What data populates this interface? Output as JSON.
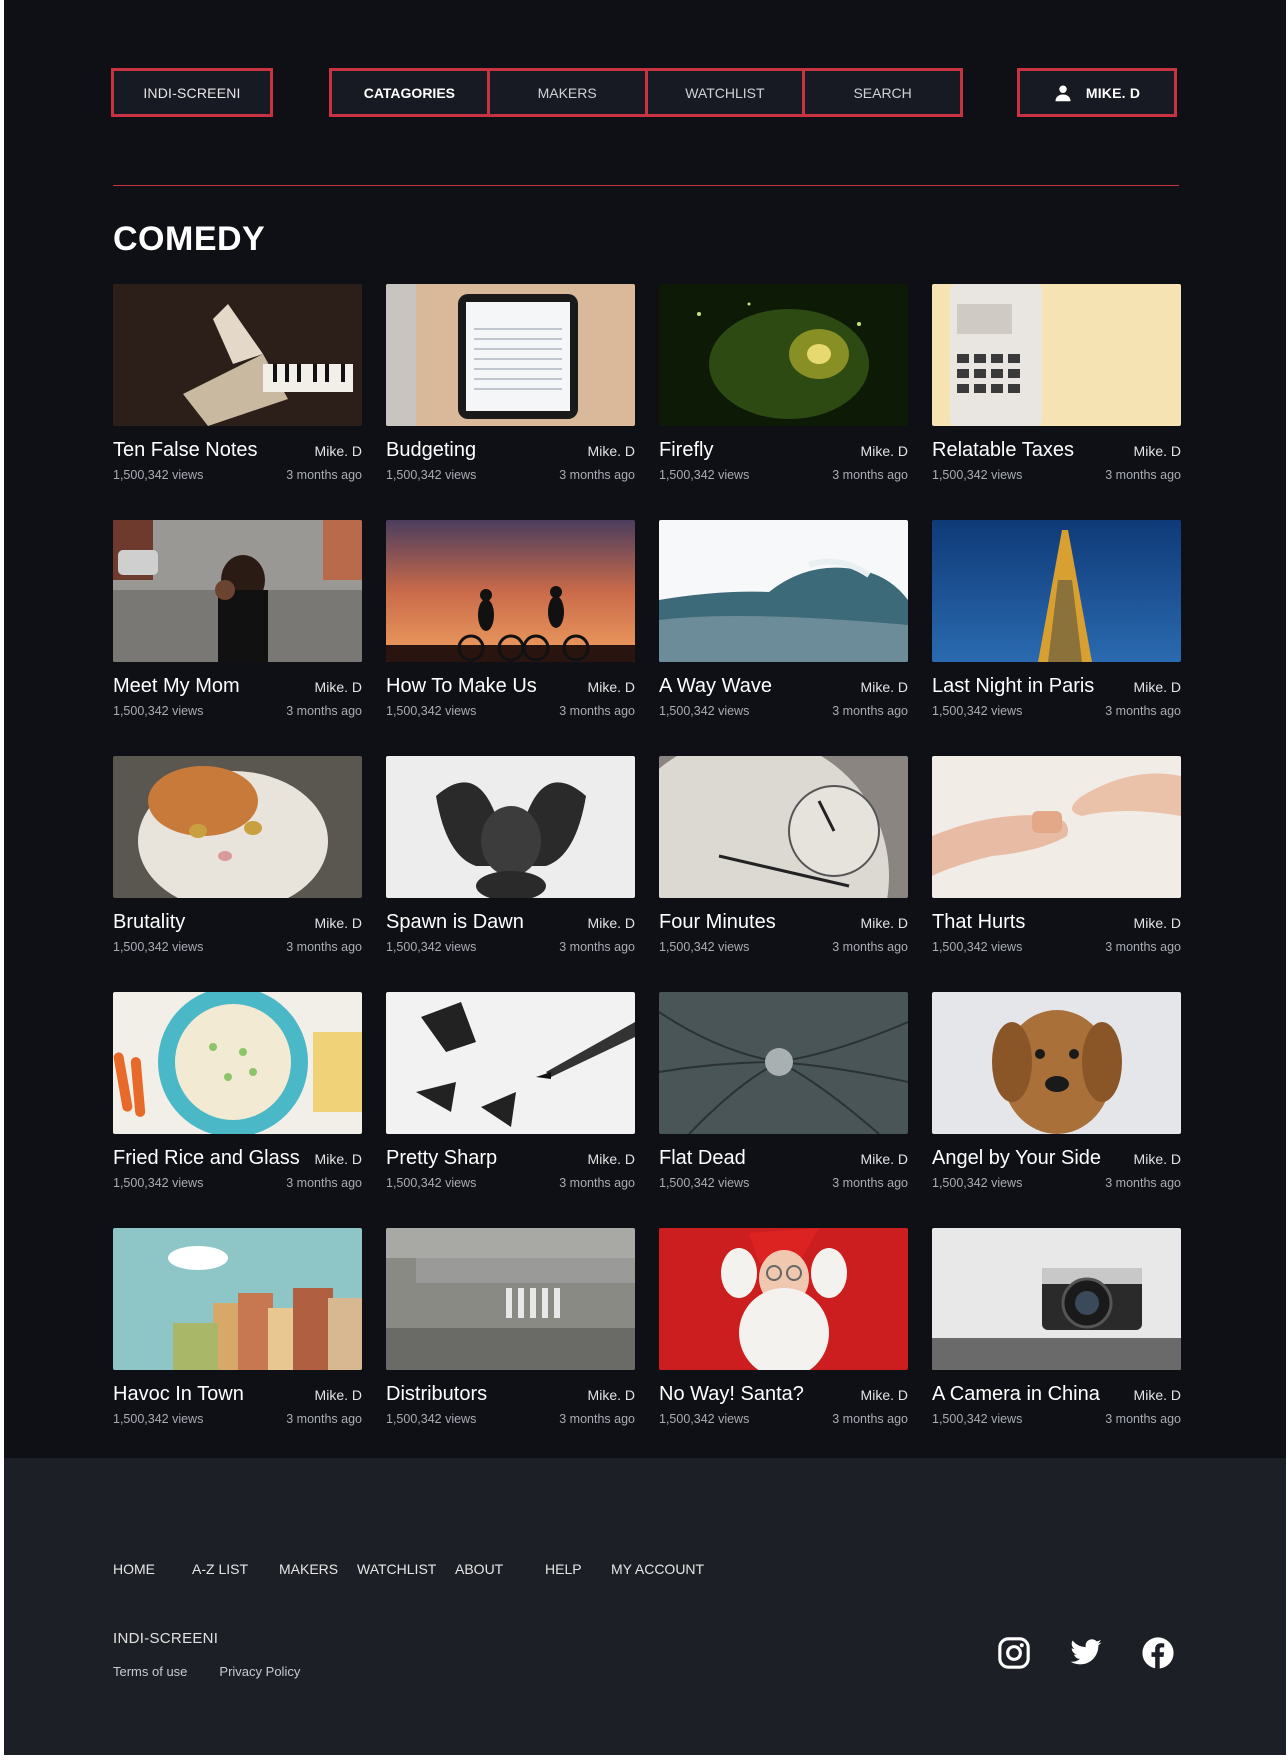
{
  "header": {
    "brand": "INDI-SCREENI",
    "nav": [
      "CATAGORIES",
      "MAKERS",
      "WATCHLIST",
      "SEARCH"
    ],
    "active_nav": "CATAGORIES",
    "user": "MIKE. D"
  },
  "section_title": "COMEDY",
  "videos": [
    {
      "title": "Ten False Notes",
      "author": "Mike. D",
      "views": "1,500,342 views",
      "age": "3 months ago"
    },
    {
      "title": "Budgeting",
      "author": "Mike. D",
      "views": "1,500,342 views",
      "age": "3 months ago"
    },
    {
      "title": "Firefly",
      "author": "Mike. D",
      "views": "1,500,342 views",
      "age": "3 months ago"
    },
    {
      "title": "Relatable Taxes",
      "author": "Mike. D",
      "views": "1,500,342 views",
      "age": "3 months ago"
    },
    {
      "title": "Meet My Mom",
      "author": "Mike. D",
      "views": "1,500,342 views",
      "age": "3 months ago"
    },
    {
      "title": "How To Make Us",
      "author": "Mike. D",
      "views": "1,500,342 views",
      "age": "3 months ago"
    },
    {
      "title": "A Way Wave",
      "author": "Mike. D",
      "views": "1,500,342 views",
      "age": "3 months ago"
    },
    {
      "title": "Last Night in Paris",
      "author": "Mike. D",
      "views": "1,500,342 views",
      "age": "3 months ago"
    },
    {
      "title": "Brutality",
      "author": "Mike. D",
      "views": "1,500,342 views",
      "age": "3 months ago"
    },
    {
      "title": "Spawn is Dawn",
      "author": "Mike. D",
      "views": "1,500,342 views",
      "age": "3 months ago"
    },
    {
      "title": "Four Minutes",
      "author": "Mike. D",
      "views": "1,500,342 views",
      "age": "3 months ago"
    },
    {
      "title": "That Hurts",
      "author": "Mike. D",
      "views": "1,500,342 views",
      "age": "3 months ago"
    },
    {
      "title": "Fried Rice and Glass",
      "author": "Mike. D",
      "views": "1,500,342 views",
      "age": "3 months ago"
    },
    {
      "title": "Pretty Sharp",
      "author": "Mike. D",
      "views": "1,500,342 views",
      "age": "3 months ago"
    },
    {
      "title": "Flat Dead",
      "author": "Mike. D",
      "views": "1,500,342 views",
      "age": "3 months ago"
    },
    {
      "title": "Angel by Your Side",
      "author": "Mike. D",
      "views": "1,500,342 views",
      "age": "3 months ago"
    },
    {
      "title": "Havoc In Town",
      "author": "Mike. D",
      "views": "1,500,342 views",
      "age": "3 months ago"
    },
    {
      "title": "Distributors",
      "author": "Mike. D",
      "views": "1,500,342 views",
      "age": "3 months ago"
    },
    {
      "title": "No Way! Santa?",
      "author": "Mike. D",
      "views": "1,500,342 views",
      "age": "3 months ago"
    },
    {
      "title": "A Camera in China",
      "author": "Mike. D",
      "views": "1,500,342 views",
      "age": "3 months ago"
    }
  ],
  "footer": {
    "nav": [
      "HOME",
      "A-Z LIST",
      "MAKERS",
      "WATCHLIST",
      "ABOUT",
      "HELP",
      "MY ACCOUNT"
    ],
    "brand": "INDI-SCREENI",
    "links": [
      "Terms of use",
      "Privacy Policy"
    ],
    "social": [
      "instagram-icon",
      "twitter-icon",
      "facebook-icon"
    ]
  },
  "colors": {
    "accent": "#c73340",
    "background": "#0e1016",
    "footer_background": "#1c1f26"
  }
}
